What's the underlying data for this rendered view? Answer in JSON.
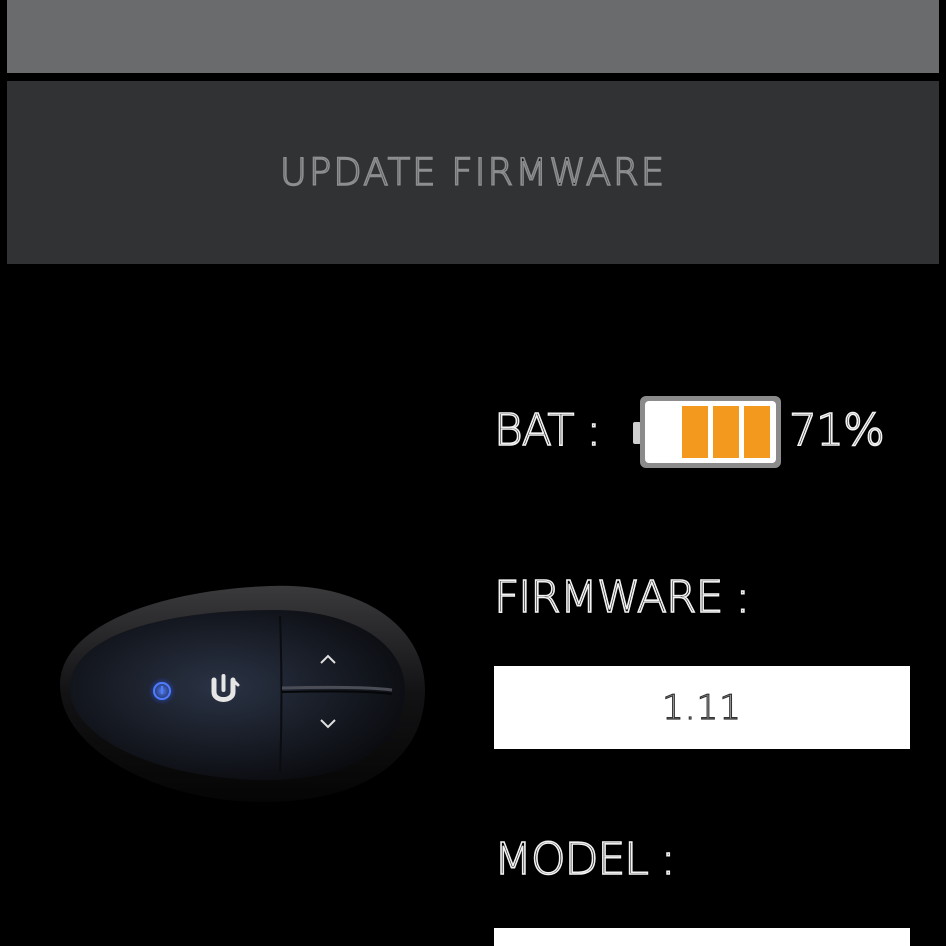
{
  "update_button": {
    "label": "Update Firmware"
  },
  "battery": {
    "label": "BAT :",
    "percent_text": "71%",
    "level": 0.71,
    "filled_segments": 3,
    "total_segments": 4,
    "fill_color": "#f39a1e"
  },
  "firmware": {
    "label": "FIRMWARE :",
    "value": "1.11"
  },
  "model": {
    "label": "MODEL :",
    "value": ""
  },
  "device": {
    "power_icon_color": "#2f6bff"
  },
  "colors": {
    "background": "#000000",
    "top_bar": "#6a6b6d",
    "button": "#313234"
  }
}
